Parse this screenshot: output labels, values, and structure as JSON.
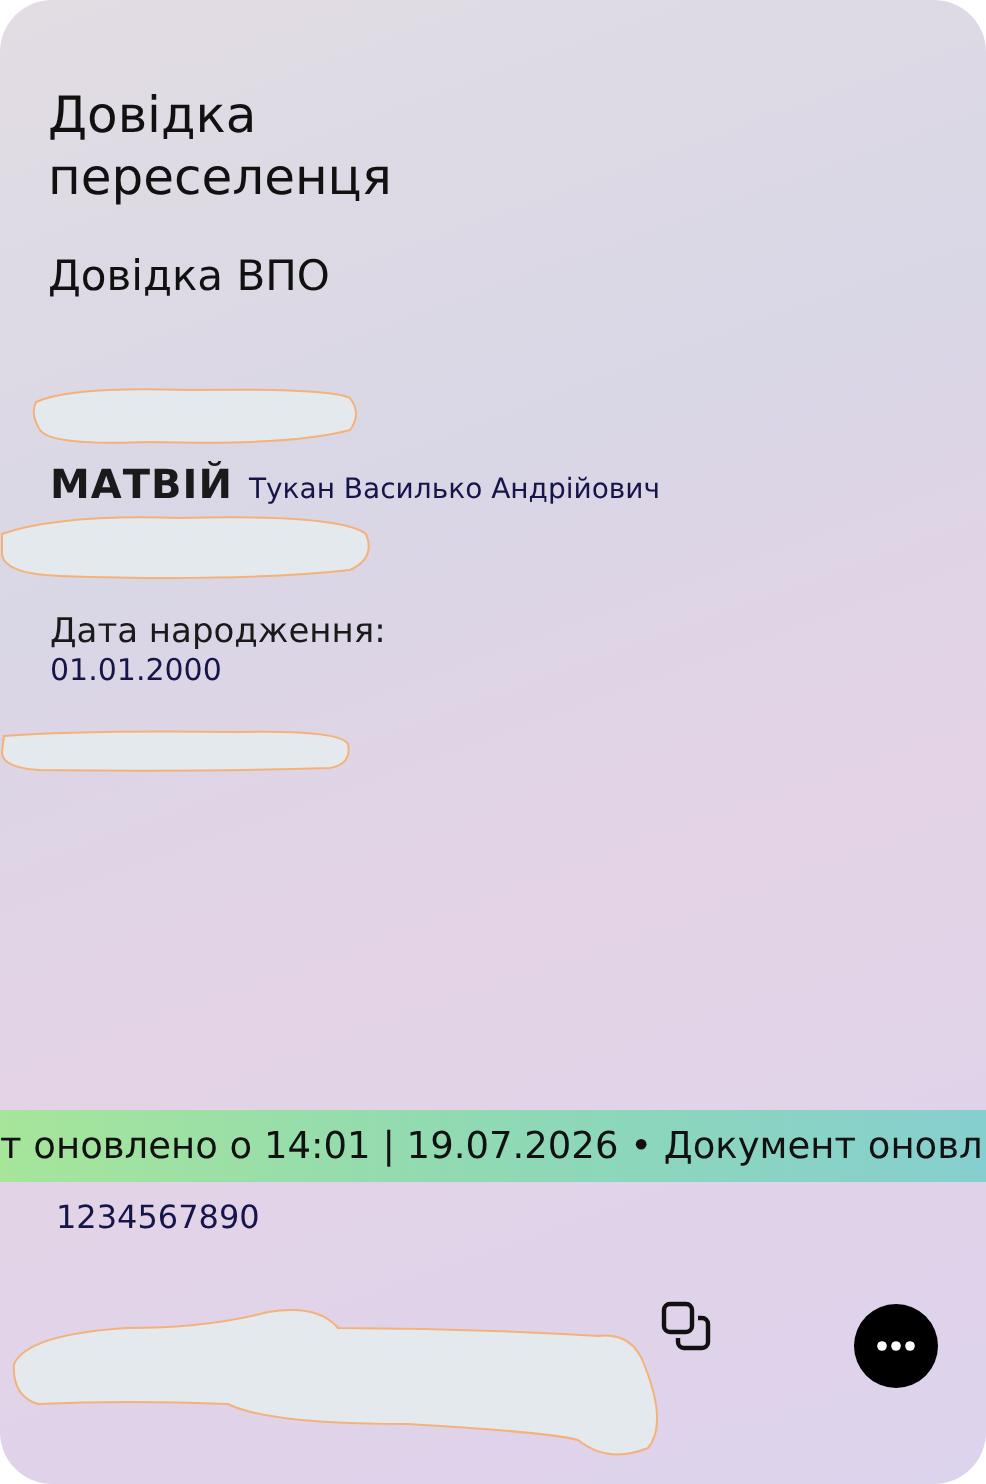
{
  "document": {
    "title": "Довідка переселенця",
    "subtitle": "Довідка ВПО",
    "given_name": "МАТВІЙ",
    "full_name_overlay": "Тукан Василько Андрійович",
    "birth_label": "Дата народження:",
    "birth_date": "01.01.2000"
  },
  "ticker": "т оновлено о 14:01 | 19.07.2026 • Документ оновл",
  "number": "1234567890"
}
